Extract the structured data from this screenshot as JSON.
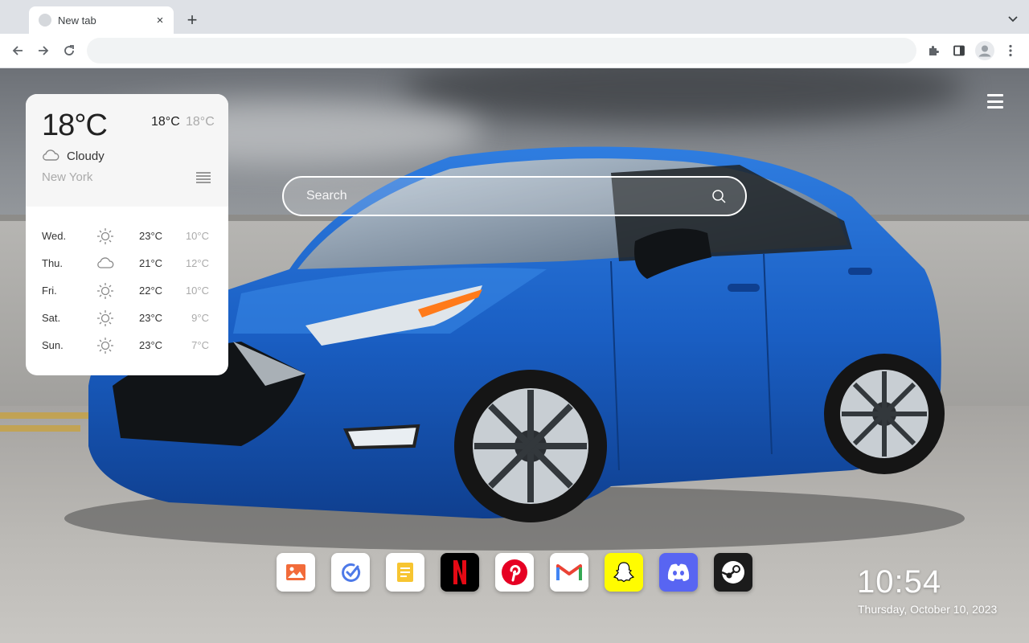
{
  "browser": {
    "tab_title": "New tab",
    "tab_close": "×",
    "new_tab": "+",
    "address_value": ""
  },
  "weather": {
    "current_temp": "18°C",
    "high": "18°C",
    "low": "18°C",
    "condition": "Cloudy",
    "condition_icon": "cloud-icon",
    "city": "New York",
    "forecast": [
      {
        "day": "Wed.",
        "icon": "sun-icon",
        "high": "23°C",
        "low": "10°C"
      },
      {
        "day": "Thu.",
        "icon": "cloud-icon",
        "high": "21°C",
        "low": "12°C"
      },
      {
        "day": "Fri.",
        "icon": "sun-icon",
        "high": "22°C",
        "low": "10°C"
      },
      {
        "day": "Sat.",
        "icon": "sun-icon",
        "high": "23°C",
        "low": "9°C"
      },
      {
        "day": "Sun.",
        "icon": "sun-icon",
        "high": "23°C",
        "low": "7°C"
      }
    ]
  },
  "search": {
    "placeholder": "Search"
  },
  "dock": {
    "apps": [
      {
        "name": "photos",
        "icon": "image-icon",
        "bg": "#ffffff"
      },
      {
        "name": "tasks",
        "icon": "check-circle-icon",
        "bg": "#ffffff"
      },
      {
        "name": "notes",
        "icon": "notes-icon",
        "bg": "#ffffff"
      },
      {
        "name": "netflix",
        "icon": "netflix-icon",
        "bg": "#000000"
      },
      {
        "name": "pinterest",
        "icon": "pinterest-icon",
        "bg": "#ffffff"
      },
      {
        "name": "gmail",
        "icon": "gmail-icon",
        "bg": "#ffffff"
      },
      {
        "name": "snapchat",
        "icon": "snapchat-icon",
        "bg": "#fffc00"
      },
      {
        "name": "discord",
        "icon": "discord-icon",
        "bg": "#5865f2"
      },
      {
        "name": "steam",
        "icon": "steam-icon",
        "bg": "#1b1b1b"
      }
    ]
  },
  "clock": {
    "time": "10:54",
    "date": "Thursday, October 10, 2023"
  },
  "colors": {
    "car_blue": "#1a5fc4",
    "netflix_red": "#e50914",
    "pinterest_red": "#e60023",
    "snapchat_yellow": "#fffc00",
    "discord_blurple": "#5865f2"
  }
}
